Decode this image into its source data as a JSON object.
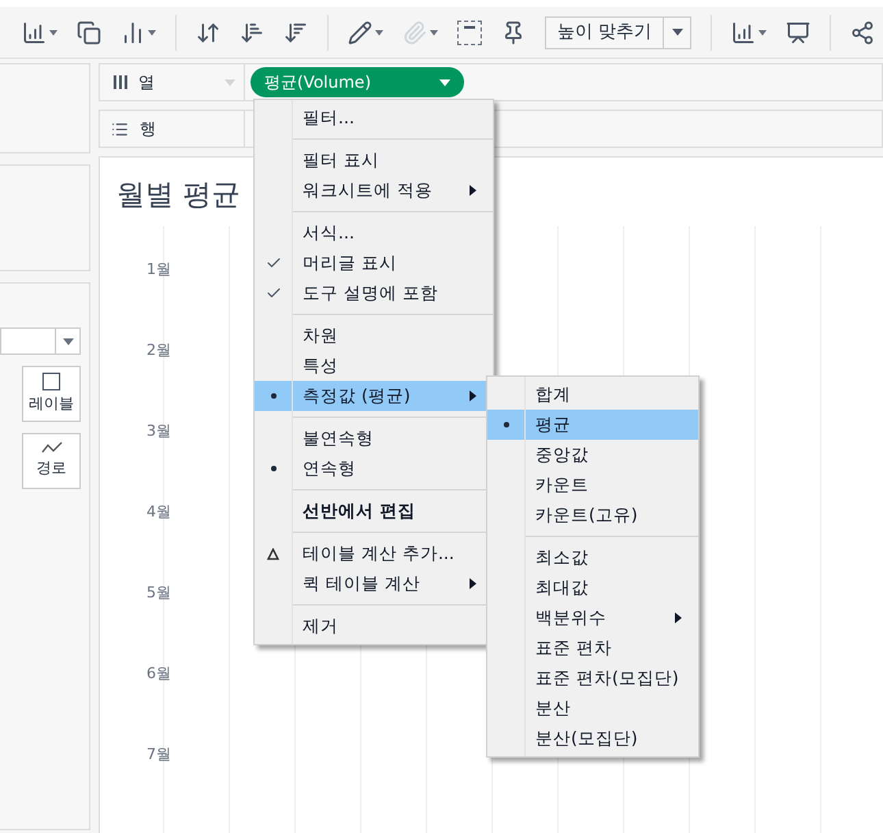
{
  "toolbar": {
    "fit_dropdown": {
      "value": "높이 맞추기"
    }
  },
  "shelves": {
    "columns": {
      "label": "열",
      "pills": [
        {
          "label": "평균(Volume)",
          "color": "#00965e"
        }
      ]
    },
    "rows": {
      "label": "행"
    }
  },
  "marks_card": {
    "buttons": [
      {
        "label": "레이블",
        "kind": "text"
      },
      {
        "label": "경로",
        "kind": "path"
      }
    ]
  },
  "chart": {
    "title": "월별 평균",
    "row_labels": [
      "1월",
      "2월",
      "3월",
      "4월",
      "5월",
      "6월",
      "7월"
    ]
  },
  "context_menu": {
    "items": [
      {
        "kind": "item",
        "label": "필터...",
        "selected": false
      },
      {
        "kind": "separator"
      },
      {
        "kind": "item",
        "label": "필터 표시",
        "selected": false
      },
      {
        "kind": "item",
        "label": "워크시트에 적용",
        "submenu": true,
        "selected": false
      },
      {
        "kind": "separator"
      },
      {
        "kind": "item",
        "label": "서식...",
        "selected": false
      },
      {
        "kind": "check",
        "label": "머리글 표시",
        "selected": false
      },
      {
        "kind": "check",
        "label": "도구 설명에 포함",
        "selected": false
      },
      {
        "kind": "separator"
      },
      {
        "kind": "item",
        "label": "차원",
        "selected": false
      },
      {
        "kind": "item",
        "label": "특성",
        "selected": false
      },
      {
        "kind": "bullet",
        "label": "측정값 (평균)",
        "submenu": true,
        "selected": true
      },
      {
        "kind": "separator"
      },
      {
        "kind": "item",
        "label": "불연속형",
        "selected": false
      },
      {
        "kind": "bullet",
        "label": "연속형",
        "selected": false
      },
      {
        "kind": "separator"
      },
      {
        "kind": "item",
        "label": "선반에서 편집",
        "bold": true,
        "selected": false
      },
      {
        "kind": "separator"
      },
      {
        "kind": "calc",
        "label": "테이블 계산 추가...",
        "selected": false
      },
      {
        "kind": "item",
        "label": "퀵 테이블 계산",
        "submenu": true,
        "selected": false
      },
      {
        "kind": "separator"
      },
      {
        "kind": "item",
        "label": "제거",
        "selected": false
      }
    ]
  },
  "submenu": {
    "items": [
      {
        "kind": "item",
        "label": "합계",
        "selected": false
      },
      {
        "kind": "bullet",
        "label": "평균",
        "selected": true
      },
      {
        "kind": "item",
        "label": "중앙값",
        "selected": false
      },
      {
        "kind": "item",
        "label": "카운트",
        "selected": false
      },
      {
        "kind": "item",
        "label": "카운트(고유)",
        "selected": false
      },
      {
        "kind": "separator"
      },
      {
        "kind": "item",
        "label": "최소값",
        "selected": false
      },
      {
        "kind": "item",
        "label": "최대값",
        "selected": false
      },
      {
        "kind": "item",
        "label": "백분위수",
        "submenu": true,
        "selected": false
      },
      {
        "kind": "item",
        "label": "표준 편차",
        "selected": false
      },
      {
        "kind": "item",
        "label": "표준 편차(모집단)",
        "selected": false
      },
      {
        "kind": "item",
        "label": "분산",
        "selected": false
      },
      {
        "kind": "item",
        "label": "분산(모집단)",
        "selected": false
      }
    ]
  }
}
